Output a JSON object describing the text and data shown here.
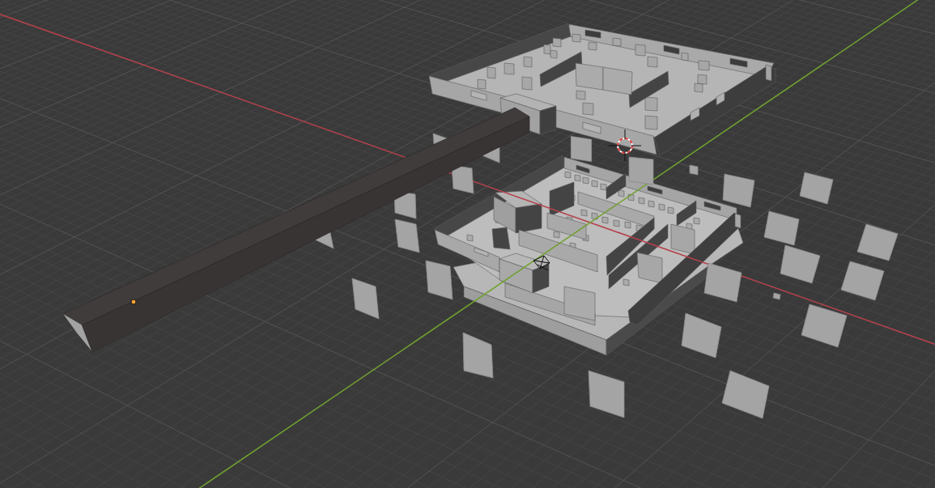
{
  "viewport": {
    "axis_lines": [
      {
        "color": "#b4414b"
      },
      {
        "color": "#70a02e"
      }
    ]
  }
}
